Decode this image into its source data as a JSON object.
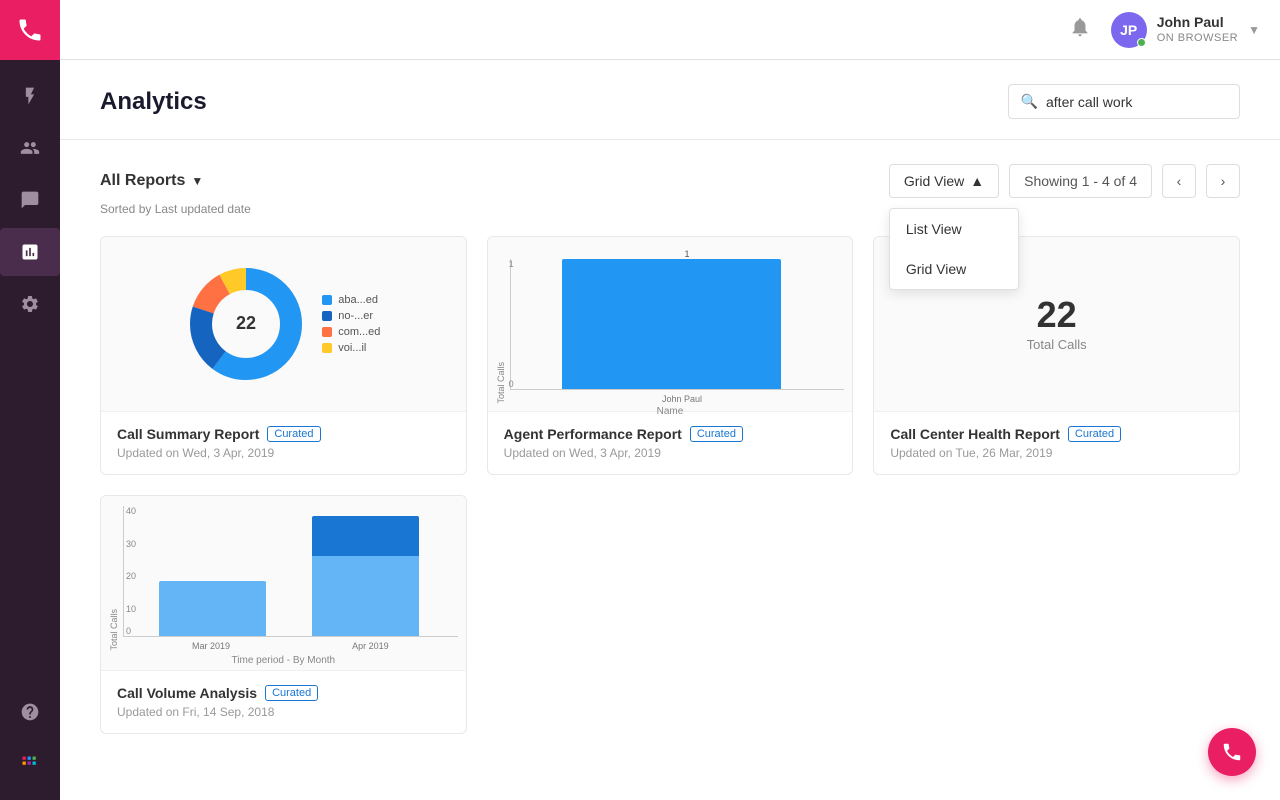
{
  "sidebar": {
    "logo_label": "Phone",
    "items": [
      {
        "id": "lightning",
        "icon": "lightning-icon",
        "active": false
      },
      {
        "id": "users",
        "icon": "users-icon",
        "active": false
      },
      {
        "id": "chat",
        "icon": "chat-icon",
        "active": false
      },
      {
        "id": "analytics",
        "icon": "analytics-icon",
        "active": true
      },
      {
        "id": "settings",
        "icon": "settings-icon",
        "active": false
      }
    ],
    "bottom_items": [
      {
        "id": "help",
        "icon": "help-icon"
      },
      {
        "id": "grid",
        "icon": "grid-icon"
      }
    ]
  },
  "topbar": {
    "user_name": "John Paul",
    "user_status": "ON BROWSER",
    "user_initials": "JP",
    "notification_icon": "bell-icon"
  },
  "page": {
    "title": "Analytics",
    "search": {
      "placeholder": "after call work",
      "value": "after call work"
    }
  },
  "reports": {
    "filter_label": "All Reports",
    "sorted_by": "Sorted by Last updated date",
    "view_label": "Grid View",
    "showing_label": "Showing 1 - 4 of 4",
    "dropdown_items": [
      {
        "label": "List View"
      },
      {
        "label": "Grid View"
      }
    ],
    "cards": [
      {
        "id": "call-summary",
        "title": "Call Summary Report",
        "badge": "Curated",
        "updated": "Updated on Wed, 3 Apr, 2019",
        "chart_type": "donut",
        "donut": {
          "center_value": "22",
          "legend": [
            {
              "label": "aba...ed",
              "color": "#2196f3"
            },
            {
              "label": "no-...er",
              "color": "#1565c0"
            },
            {
              "label": "com...ed",
              "color": "#ff7043"
            },
            {
              "label": "voi...il",
              "color": "#ffca28"
            }
          ]
        }
      },
      {
        "id": "agent-performance",
        "title": "Agent Performance Report",
        "badge": "Curated",
        "updated": "Updated on Wed, 3 Apr, 2019",
        "chart_type": "bar",
        "bar": {
          "y_label": "Total Calls",
          "x_label": "Name",
          "bars": [
            {
              "name": "John Paul",
              "value": 1,
              "height": 120,
              "top_label": "1"
            }
          ],
          "y_ticks": [
            "1",
            "0"
          ]
        }
      },
      {
        "id": "call-center-health",
        "title": "Call Center Health Report",
        "badge": "Curated",
        "updated": "Updated on Tue, 26 Mar, 2019",
        "chart_type": "number",
        "number": {
          "value": "22",
          "label": "Total Calls"
        }
      },
      {
        "id": "call-volume",
        "title": "Call Volume Analysis",
        "badge": "Curated",
        "updated": "Updated on Fri, 14 Sep, 2018",
        "chart_type": "stacked_bar",
        "stacked_bar": {
          "y_label": "Total Calls",
          "x_label": "Time period - By Month",
          "y_max": 40,
          "y_ticks": [
            "40",
            "30",
            "20",
            "10",
            "0"
          ],
          "bars": [
            {
              "name": "Mar 2019",
              "bottom_height": 55,
              "top_height": 0,
              "bottom_color": "#64b5f6",
              "top_color": "#1976d2"
            },
            {
              "name": "Apr 2019",
              "bottom_height": 80,
              "top_height": 40,
              "bottom_color": "#64b5f6",
              "top_color": "#1976d2"
            }
          ]
        }
      }
    ]
  },
  "floating_phone": {
    "label": "Call Button"
  }
}
